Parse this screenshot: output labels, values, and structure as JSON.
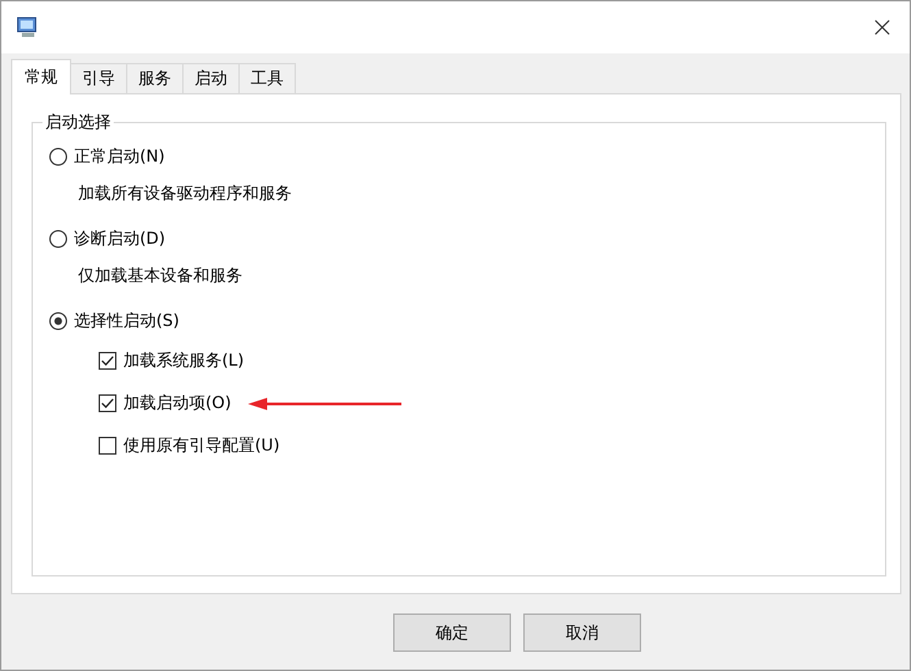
{
  "tabs": [
    {
      "label": "常规",
      "selected": true
    },
    {
      "label": "引导",
      "selected": false
    },
    {
      "label": "服务",
      "selected": false
    },
    {
      "label": "启动",
      "selected": false
    },
    {
      "label": "工具",
      "selected": false
    }
  ],
  "group": {
    "title": "启动选择",
    "modes": [
      {
        "label": "正常启动(N)",
        "selected": false,
        "description": "加载所有设备驱动程序和服务"
      },
      {
        "label": "诊断启动(D)",
        "selected": false,
        "description": "仅加载基本设备和服务"
      },
      {
        "label": "选择性启动(S)",
        "selected": true
      }
    ],
    "options": [
      {
        "label": "加载系统服务(L)",
        "checked": true,
        "pointed": false
      },
      {
        "label": "加载启动项(O)",
        "checked": true,
        "pointed": true
      },
      {
        "label": "使用原有引导配置(U)",
        "checked": false,
        "pointed": false
      }
    ]
  },
  "buttons": [
    "确定",
    "取消"
  ]
}
